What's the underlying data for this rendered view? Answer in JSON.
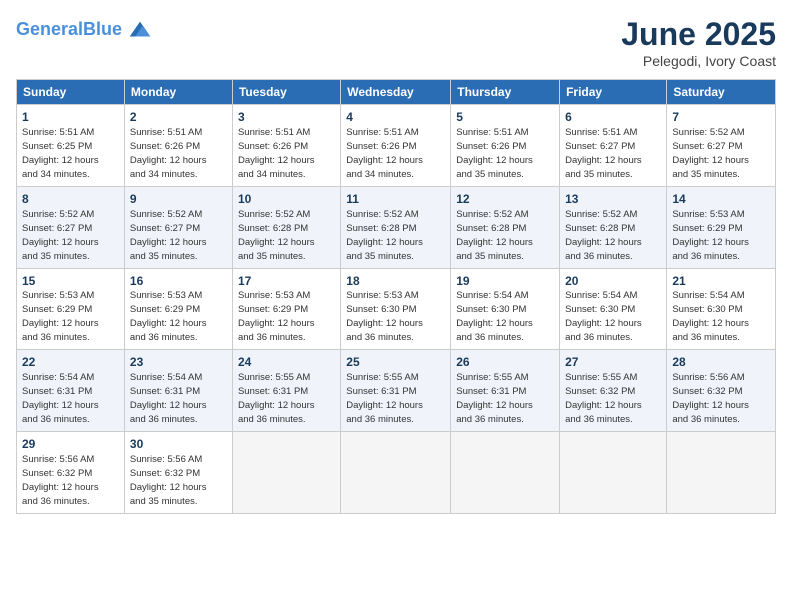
{
  "header": {
    "logo_line1": "General",
    "logo_line2": "Blue",
    "title": "June 2025",
    "subtitle": "Pelegodi, Ivory Coast"
  },
  "days_of_week": [
    "Sunday",
    "Monday",
    "Tuesday",
    "Wednesday",
    "Thursday",
    "Friday",
    "Saturday"
  ],
  "weeks": [
    [
      {
        "day": "1",
        "info": "Sunrise: 5:51 AM\nSunset: 6:25 PM\nDaylight: 12 hours\nand 34 minutes."
      },
      {
        "day": "2",
        "info": "Sunrise: 5:51 AM\nSunset: 6:26 PM\nDaylight: 12 hours\nand 34 minutes."
      },
      {
        "day": "3",
        "info": "Sunrise: 5:51 AM\nSunset: 6:26 PM\nDaylight: 12 hours\nand 34 minutes."
      },
      {
        "day": "4",
        "info": "Sunrise: 5:51 AM\nSunset: 6:26 PM\nDaylight: 12 hours\nand 34 minutes."
      },
      {
        "day": "5",
        "info": "Sunrise: 5:51 AM\nSunset: 6:26 PM\nDaylight: 12 hours\nand 35 minutes."
      },
      {
        "day": "6",
        "info": "Sunrise: 5:51 AM\nSunset: 6:27 PM\nDaylight: 12 hours\nand 35 minutes."
      },
      {
        "day": "7",
        "info": "Sunrise: 5:52 AM\nSunset: 6:27 PM\nDaylight: 12 hours\nand 35 minutes."
      }
    ],
    [
      {
        "day": "8",
        "info": "Sunrise: 5:52 AM\nSunset: 6:27 PM\nDaylight: 12 hours\nand 35 minutes."
      },
      {
        "day": "9",
        "info": "Sunrise: 5:52 AM\nSunset: 6:27 PM\nDaylight: 12 hours\nand 35 minutes."
      },
      {
        "day": "10",
        "info": "Sunrise: 5:52 AM\nSunset: 6:28 PM\nDaylight: 12 hours\nand 35 minutes."
      },
      {
        "day": "11",
        "info": "Sunrise: 5:52 AM\nSunset: 6:28 PM\nDaylight: 12 hours\nand 35 minutes."
      },
      {
        "day": "12",
        "info": "Sunrise: 5:52 AM\nSunset: 6:28 PM\nDaylight: 12 hours\nand 35 minutes."
      },
      {
        "day": "13",
        "info": "Sunrise: 5:52 AM\nSunset: 6:28 PM\nDaylight: 12 hours\nand 36 minutes."
      },
      {
        "day": "14",
        "info": "Sunrise: 5:53 AM\nSunset: 6:29 PM\nDaylight: 12 hours\nand 36 minutes."
      }
    ],
    [
      {
        "day": "15",
        "info": "Sunrise: 5:53 AM\nSunset: 6:29 PM\nDaylight: 12 hours\nand 36 minutes."
      },
      {
        "day": "16",
        "info": "Sunrise: 5:53 AM\nSunset: 6:29 PM\nDaylight: 12 hours\nand 36 minutes."
      },
      {
        "day": "17",
        "info": "Sunrise: 5:53 AM\nSunset: 6:29 PM\nDaylight: 12 hours\nand 36 minutes."
      },
      {
        "day": "18",
        "info": "Sunrise: 5:53 AM\nSunset: 6:30 PM\nDaylight: 12 hours\nand 36 minutes."
      },
      {
        "day": "19",
        "info": "Sunrise: 5:54 AM\nSunset: 6:30 PM\nDaylight: 12 hours\nand 36 minutes."
      },
      {
        "day": "20",
        "info": "Sunrise: 5:54 AM\nSunset: 6:30 PM\nDaylight: 12 hours\nand 36 minutes."
      },
      {
        "day": "21",
        "info": "Sunrise: 5:54 AM\nSunset: 6:30 PM\nDaylight: 12 hours\nand 36 minutes."
      }
    ],
    [
      {
        "day": "22",
        "info": "Sunrise: 5:54 AM\nSunset: 6:31 PM\nDaylight: 12 hours\nand 36 minutes."
      },
      {
        "day": "23",
        "info": "Sunrise: 5:54 AM\nSunset: 6:31 PM\nDaylight: 12 hours\nand 36 minutes."
      },
      {
        "day": "24",
        "info": "Sunrise: 5:55 AM\nSunset: 6:31 PM\nDaylight: 12 hours\nand 36 minutes."
      },
      {
        "day": "25",
        "info": "Sunrise: 5:55 AM\nSunset: 6:31 PM\nDaylight: 12 hours\nand 36 minutes."
      },
      {
        "day": "26",
        "info": "Sunrise: 5:55 AM\nSunset: 6:31 PM\nDaylight: 12 hours\nand 36 minutes."
      },
      {
        "day": "27",
        "info": "Sunrise: 5:55 AM\nSunset: 6:32 PM\nDaylight: 12 hours\nand 36 minutes."
      },
      {
        "day": "28",
        "info": "Sunrise: 5:56 AM\nSunset: 6:32 PM\nDaylight: 12 hours\nand 36 minutes."
      }
    ],
    [
      {
        "day": "29",
        "info": "Sunrise: 5:56 AM\nSunset: 6:32 PM\nDaylight: 12 hours\nand 36 minutes."
      },
      {
        "day": "30",
        "info": "Sunrise: 5:56 AM\nSunset: 6:32 PM\nDaylight: 12 hours\nand 35 minutes."
      },
      {
        "day": "",
        "info": ""
      },
      {
        "day": "",
        "info": ""
      },
      {
        "day": "",
        "info": ""
      },
      {
        "day": "",
        "info": ""
      },
      {
        "day": "",
        "info": ""
      }
    ]
  ]
}
